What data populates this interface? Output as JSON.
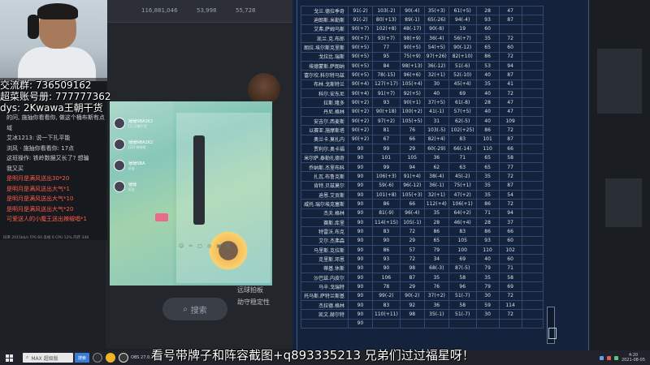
{
  "webcam": {
    "title": "streamer webcam"
  },
  "overlay": {
    "line1": "交流群: 736509162",
    "line2": "超菜账号册: 777777362",
    "line3": "dys: 2Kwawa王朝干货"
  },
  "chat": {
    "messages": [
      {
        "text": "的问, 施抽你看看你, 做这个桶布斯有点",
        "style": "normal"
      },
      {
        "text": "域",
        "style": "normal"
      },
      {
        "text": "艾冰1213: 说一下扎平能",
        "style": "normal"
      },
      {
        "text": "浏风 · 施抽你看看你: 17点",
        "style": "normal"
      },
      {
        "text": "这班操作: 铁岭数据又长了? 想骗",
        "style": "normal"
      },
      {
        "text": "我又买",
        "style": "normal"
      },
      {
        "text": "是明月是满风送出30*20",
        "style": "red"
      },
      {
        "text": "是明月是满风送出大气*1",
        "style": "red"
      },
      {
        "text": "是明月是满风送出大气*10",
        "style": "red"
      },
      {
        "text": "是明月是满风送出大气*20",
        "style": "red"
      },
      {
        "text": "可爱送人的小魔王送出辣椒唱*1",
        "style": "red"
      }
    ],
    "stats": "码率 2015kb/s  FPS 60  丢帧 0  CPU 12%  内存 348"
  },
  "qq": {
    "contacts": [
      {
        "name": "锤锤NBA2K2",
        "sub": "[2] 王朝干货"
      },
      {
        "name": "锤锤NBA2K2",
        "sub": "[22] 哈哈哈"
      },
      {
        "name": "锤锤NBA",
        "sub": "好友"
      },
      {
        "name": "锤锤",
        "sub": "好友"
      }
    ],
    "tools": [
      "☺",
      "✂",
      "▢",
      "◎",
      "▣",
      "☰"
    ]
  },
  "background": {
    "top_numbers": [
      "116,881,046",
      "53,998",
      "55,728"
    ],
    "menu": [
      "远球拍板",
      "助守稳定性"
    ],
    "search_label": "搜索"
  },
  "table": {
    "rows": [
      [
        "戈兰.德拉季奇",
        "91(-2)",
        "103(-2)",
        "90(-4)",
        "35(+3)",
        "61(+5)",
        "28",
        "47",
        ""
      ],
      [
        "迪朗斯.米勒斯",
        "91(-2)",
        "80(+13)",
        "89(-1)",
        "65(-26)",
        "94(-4)",
        "93",
        "87",
        ""
      ],
      [
        "艾弗.萨姆乌斯",
        "90(+7)",
        "102(+8)",
        "48(-17)",
        "90(-8)",
        "19",
        "60",
        ""
      ],
      [
        "凯兰.克.布郎",
        "90(+7)",
        "93(+7)",
        "98(+9)",
        "36(-4)",
        "56(+7)",
        "35",
        "72",
        ""
      ],
      [
        "朗拉.埃尔斯克里斯",
        "90(+5)",
        "77",
        "90(+5)",
        "54(+5)",
        "90(-12)",
        "65",
        "60",
        ""
      ],
      [
        "戈拉比.瑞斯",
        "90(+5)",
        "95",
        "75(+9)",
        "97(+26)",
        "82(+10)",
        "86",
        "72",
        ""
      ],
      [
        "埃德蒙斯.萨朗纳",
        "90(+5)",
        "84",
        "98(+13)",
        "36(-12)",
        "51(-6)",
        "53",
        "94",
        ""
      ],
      [
        "富尔坎.科尔特马兹",
        "90(+5)",
        "78(-15)",
        "96(+6)",
        "32(+1)",
        "52(-10)",
        "40",
        "87",
        ""
      ],
      [
        "布林.戈斯特兰",
        "90(+4)",
        "127(+17)",
        "105(+4)",
        "30",
        "45(+4)",
        "35",
        "41",
        ""
      ],
      [
        "科尔.安东尼",
        "90(+4)",
        "91(+7)",
        "92(+5)",
        "40",
        "69",
        "40",
        "72",
        ""
      ],
      [
        "拉斯.隆多",
        "90(+2)",
        "93",
        "90(+1)",
        "37(+5)",
        "61(-8)",
        "28",
        "47",
        ""
      ],
      [
        "丹尼.格林",
        "90(+2)",
        "90(+18)",
        "100(+2)",
        "41(-1)",
        "57(+5)",
        "40",
        "47",
        ""
      ],
      [
        "安吉尔.西麦斯",
        "90(+2)",
        "97(+2)",
        "105(+5)",
        "31",
        "62(-5)",
        "40",
        "109",
        ""
      ],
      [
        "以赛亚.施摩斯塔",
        "90(+2)",
        "81",
        "76",
        "103(-5)",
        "102(+25)",
        "86",
        "72",
        ""
      ],
      [
        "奥兰卡.莫扎内",
        "90(+2)",
        "67",
        "66",
        "82(+4)",
        "83",
        "101",
        "87",
        ""
      ],
      [
        "贾利尔.奥卡福",
        "90",
        "99",
        "29",
        "60(-29)",
        "66(-14)",
        "110",
        "66",
        ""
      ],
      [
        "米尔萨.泰勒扎德奇",
        "90",
        "101",
        "105",
        "36",
        "71",
        "65",
        "58",
        ""
      ],
      [
        "乔纳斯.杰里布科",
        "90",
        "99",
        "94",
        "62",
        "63",
        "65",
        "77",
        ""
      ],
      [
        "扎瓦.布鲁克斯",
        "90",
        "106(+3)",
        "91(+4)",
        "38(-4)",
        "45(-2)",
        "35",
        "72",
        ""
      ],
      [
        "肯特.贝兹莫尔",
        "90",
        "59(-6)",
        "96(-12)",
        "36(-1)",
        "75(+1)",
        "35",
        "87",
        ""
      ],
      [
        "迪恩.艾贡斯",
        "90",
        "101(+8)",
        "105(+3)",
        "32(+1)",
        "47(+2)",
        "35",
        "54",
        ""
      ],
      [
        "威托.瑞尔埃克塞斯",
        "90",
        "86",
        "66",
        "112(+4)",
        "106(+1)",
        "86",
        "72",
        ""
      ],
      [
        "杰夫.格林",
        "90",
        "81(-9)",
        "96(-4)",
        "35",
        "64(+2)",
        "71",
        "94",
        ""
      ],
      [
        "赛斯.库里",
        "90",
        "114(+15)",
        "105(-1)",
        "28",
        "46(+4)",
        "28",
        "37",
        ""
      ],
      [
        "特雷沃.布克",
        "90",
        "83",
        "72",
        "86",
        "83",
        "86",
        "66",
        ""
      ],
      [
        "艾尔.杰弗森",
        "90",
        "90",
        "29",
        "65",
        "105",
        "93",
        "60",
        ""
      ],
      [
        "马里斯.克拉斯",
        "90",
        "86",
        "57",
        "79",
        "100",
        "110",
        "102",
        ""
      ],
      [
        "克里斯.邓恩",
        "90",
        "93",
        "72",
        "34",
        "69",
        "40",
        "60",
        ""
      ],
      [
        "蒂基.休斯",
        "90",
        "90",
        "98",
        "68(-3)",
        "87(-5)",
        "79",
        "71",
        ""
      ],
      [
        "沙巴兹.内皮尔",
        "90",
        "106",
        "87",
        "35",
        "58",
        "35",
        "58",
        ""
      ],
      [
        "马辛.戈瑞特",
        "90",
        "78",
        "29",
        "76",
        "96",
        "79",
        "69",
        ""
      ],
      [
        "托马斯.萨特兰斯基",
        "90",
        "99(-2)",
        "90(-2)",
        "37(+2)",
        "51(-7)",
        "30",
        "72",
        ""
      ],
      [
        "杰拉德.格林",
        "90",
        "83",
        "92",
        "36",
        "58",
        "59",
        "114",
        ""
      ],
      [
        "凯文.赫尔特",
        "90",
        "110(+11)",
        "98",
        "35(-1)",
        "51(-7)",
        "30",
        "72",
        ""
      ],
      [
        "",
        "90",
        "",
        "",
        "",
        "",
        "",
        "",
        ""
      ]
    ]
  },
  "caption": "看号带牌子和阵容截图+q893335213 兄弟们过过福星呀！",
  "taskbar": {
    "search_text": "MAX 超级版",
    "search_button": "搜索",
    "app": "OBS 27.0.1 ...",
    "time": "4:20",
    "date": "2021-08-05"
  }
}
